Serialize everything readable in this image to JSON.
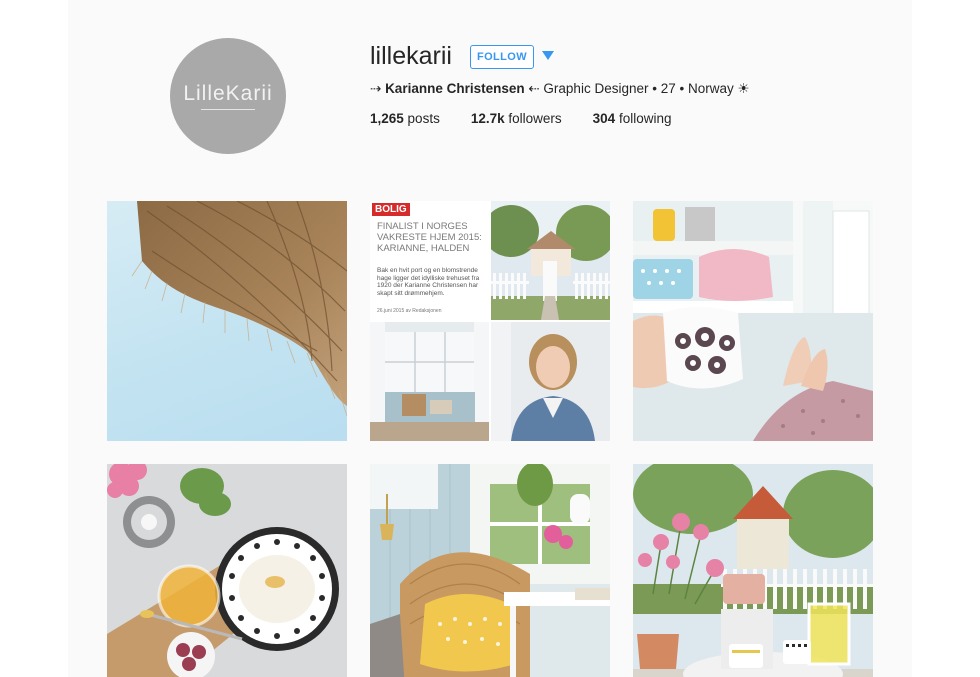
{
  "profile": {
    "avatar_text": "LilleKarii",
    "username": "lillekarii",
    "follow_label": "FOLLOW",
    "bio_prefix": "⇢ ",
    "bio_name": "Karianne Christensen",
    "bio_rest": " ⇠ Graphic Designer • 27 • Norway ☀",
    "stats": {
      "posts_count": "1,265",
      "posts_label": " posts",
      "followers_count": "12.7k",
      "followers_label": " followers",
      "following_count": "304",
      "following_label": " following"
    }
  },
  "magazine": {
    "brand": "BOLIG",
    "headline": "FINALIST I NORGES VAKRESTE HJEM 2015: KARIANNE, HALDEN",
    "subtext": "Bak en hvit port og en blomstrende hage ligger det idylliske trehuset fra 1920 der Karianne Christensen har skapt sitt drømmehjem.",
    "date": "26.juni 2015 av Redaksjonen"
  },
  "colors": {
    "accent": "#3897f0",
    "text": "#262626",
    "avatar_bg": "#a9a9a9",
    "page_bg": "#fafafa"
  }
}
